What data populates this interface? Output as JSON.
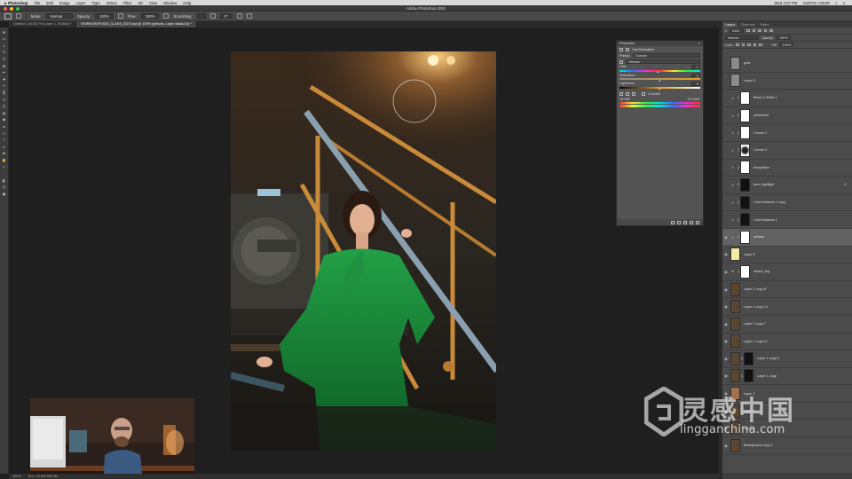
{
  "menubar": {
    "apple": "",
    "items": [
      "Photoshop",
      "File",
      "Edit",
      "Image",
      "Layer",
      "Type",
      "Select",
      "Filter",
      "3D",
      "View",
      "Window",
      "Help"
    ],
    "clock": "Wed 2:07 PM",
    "user": "JUSTIN J MUIR"
  },
  "window": {
    "title": "Adobe Photoshop 2020",
    "traffic_colors": [
      "#ff5f57",
      "#febc2e",
      "#28c840"
    ]
  },
  "options": {
    "mode_label": "Mode:",
    "mode_value": "Normal",
    "opacity_label": "Opacity:",
    "opacity_value": "100%",
    "flow_label": "Flow:",
    "flow_value": "100%",
    "smoothing_label": "Smoothing:",
    "angle_value": "0°"
  },
  "tabs": [
    {
      "label": "Untitled-1 @ 66.7% (Layer 1, RGB/8) *",
      "active": false
    },
    {
      "label": "WORKSHOP2020_CLASS_EDIT.psd @ 100% (yellows, Layer Mask/16) *",
      "active": true
    }
  ],
  "status": {
    "zoom": "100%",
    "doc": "Doc: 24.9M/798.0M"
  },
  "properties": {
    "title": "Properties",
    "adjustment": "Hue/Saturation",
    "preset_label": "Preset:",
    "preset_value": "Custom",
    "channel_value": "Yellows",
    "hue_label": "Hue:",
    "hue_value": "-7",
    "hue_fraction": 0.48,
    "saturation_label": "Saturation:",
    "saturation_value": "0",
    "saturation_fraction": 0.5,
    "lightness_label": "Lightness:",
    "lightness_value": "0",
    "lightness_fraction": 0.5,
    "colorize_label": "Colorize",
    "range_left": "15°/45°",
    "range_right": "75°/105°"
  },
  "layers": {
    "tabs": [
      "Layers",
      "Channels",
      "Paths"
    ],
    "kind_label": "Kind",
    "blend_mode": "Normal",
    "opacity_label": "Opacity:",
    "opacity_value": "100%",
    "lock_label": "Lock:",
    "fill_label": "Fill:",
    "fill_value": "100%",
    "items": [
      {
        "name": "grain",
        "type": "pixel",
        "thumb": "#8a8a8a",
        "mask": false,
        "visible": false,
        "selected": false
      },
      {
        "name": "Layer 8",
        "type": "pixel",
        "thumb": "#8a8a8a",
        "mask": false,
        "visible": false,
        "selected": false
      },
      {
        "name": "Black & White 1",
        "type": "adjustment",
        "thumb": "",
        "mask": true,
        "visible": false,
        "selected": false
      },
      {
        "name": "yellowfeet",
        "type": "adjustment",
        "thumb": "",
        "mask": true,
        "visible": false,
        "selected": false
      },
      {
        "name": "Curves 2",
        "type": "adjustment",
        "thumb": "",
        "mask": true,
        "visible": false,
        "selected": false
      },
      {
        "name": "Curves 0",
        "type": "adjustment",
        "thumb": "",
        "mask": true,
        "visible": false,
        "selected": false
      },
      {
        "name": "blueyellow",
        "type": "adjustment",
        "thumb": "",
        "mask": true,
        "visible": false,
        "selected": false
      },
      {
        "name": "face_highlight",
        "type": "adjustment",
        "thumb": "",
        "mask": true,
        "visible": false,
        "selected": false,
        "fx": true
      },
      {
        "name": "Color Balance 1 copy",
        "type": "adjustment",
        "thumb": "",
        "mask": true,
        "visible": false,
        "selected": false
      },
      {
        "name": "Color Balance 1",
        "type": "adjustment",
        "thumb": "",
        "mask": true,
        "visible": false,
        "selected": false
      },
      {
        "name": "yellows",
        "type": "adjustment",
        "thumb": "",
        "mask": true,
        "visible": true,
        "selected": true
      },
      {
        "name": "Layer 5",
        "type": "pixel",
        "thumb": "#f3eaa6",
        "mask": false,
        "visible": true,
        "selected": false
      },
      {
        "name": "added_fog",
        "type": "group",
        "thumb": "",
        "mask": true,
        "visible": true,
        "selected": false
      },
      {
        "name": "Layer 1 copy 8",
        "type": "pixel",
        "thumb": "#5a4630",
        "mask": false,
        "visible": true,
        "selected": false
      },
      {
        "name": "Layer 1 copy 14",
        "type": "pixel",
        "thumb": "#5a4630",
        "mask": false,
        "visible": true,
        "selected": false
      },
      {
        "name": "Layer 1 copy 7",
        "type": "pixel",
        "thumb": "#5a4630",
        "mask": false,
        "visible": true,
        "selected": false
      },
      {
        "name": "Layer 1 copy 11",
        "type": "pixel",
        "thumb": "#5a4630",
        "mask": false,
        "visible": true,
        "selected": false
      },
      {
        "name": "Layer 1 copy 2",
        "type": "pixel",
        "thumb": "#5a4630",
        "mask": true,
        "visible": true,
        "selected": false
      },
      {
        "name": "Layer 1 copy",
        "type": "pixel",
        "thumb": "#5a4630",
        "mask": true,
        "visible": true,
        "selected": false
      },
      {
        "name": "Layer 2",
        "type": "pixel",
        "thumb": "#a0704a",
        "mask": false,
        "visible": true,
        "selected": false
      },
      {
        "name": "Layer 3",
        "type": "pixel",
        "thumb": "#5a4630",
        "mask": false,
        "visible": true,
        "selected": false
      },
      {
        "name": "Layer 1",
        "type": "pixel",
        "thumb": "#5a4630",
        "mask": false,
        "visible": true,
        "selected": false
      },
      {
        "name": "Background copy 2",
        "type": "pixel",
        "thumb": "#5a4630",
        "mask": false,
        "visible": true,
        "selected": false
      }
    ]
  },
  "watermark": {
    "cn": "灵感中国",
    "url": "lingganchina.com"
  }
}
